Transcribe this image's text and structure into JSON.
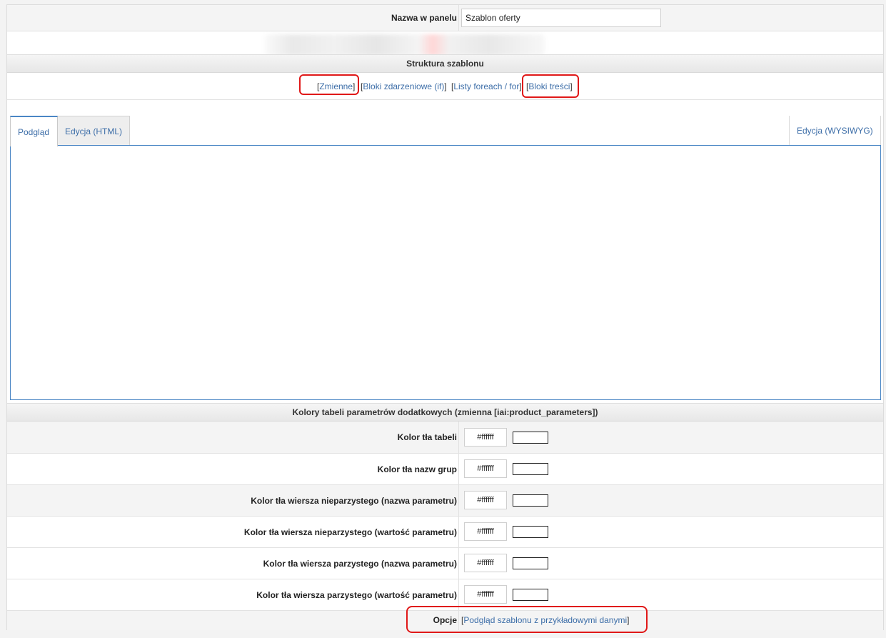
{
  "name_row": {
    "label": "Nazwa w panelu",
    "value": "Szablon oferty"
  },
  "structure": {
    "header": "Struktura szablonu",
    "links": [
      {
        "open": "[",
        "text": "Zmienne",
        "close": "]"
      },
      {
        "open": "[",
        "text": "Bloki zdarzeniowe (if)",
        "close": "]"
      },
      {
        "open": "[",
        "text": "Listy foreach / for",
        "close": "]"
      },
      {
        "open": "[",
        "text": "Bloki treści",
        "close": "]"
      }
    ]
  },
  "tabs": {
    "preview": "Podgląd",
    "html": "Edycja (HTML)",
    "wysiwyg": "Edycja (WYSIWYG)"
  },
  "colors": {
    "header": "Kolory tabeli parametrów dodatkowych (zmienna [iai:product_parameters])",
    "rows": [
      {
        "label": "Kolor tła tabeli",
        "value": "#ffffff",
        "swatch": "#ffffff"
      },
      {
        "label": "Kolor tła nazw grup",
        "value": "#ffffff",
        "swatch": "#ffffff"
      },
      {
        "label": "Kolor tła wiersza nieparzystego (nazwa parametru)",
        "value": "#ffffff",
        "swatch": "#ffffff"
      },
      {
        "label": "Kolor tła wiersza nieparzystego (wartość parametru)",
        "value": "#ffffff",
        "swatch": "#ffffff"
      },
      {
        "label": "Kolor tła wiersza parzystego (nazwa parametru)",
        "value": "#ffffff",
        "swatch": "#ffffff"
      },
      {
        "label": "Kolor tła wiersza parzystego (wartość parametru)",
        "value": "#ffffff",
        "swatch": "#ffffff"
      }
    ]
  },
  "options": {
    "label": "Opcje",
    "link_open": "[",
    "link_text": "Podgląd szablonu z przykładowymi danymi",
    "link_close": "]"
  },
  "accent_colors": {
    "link": "#3d6ea8",
    "highlight": "#e01818",
    "editor_border": "#4a86c5"
  }
}
